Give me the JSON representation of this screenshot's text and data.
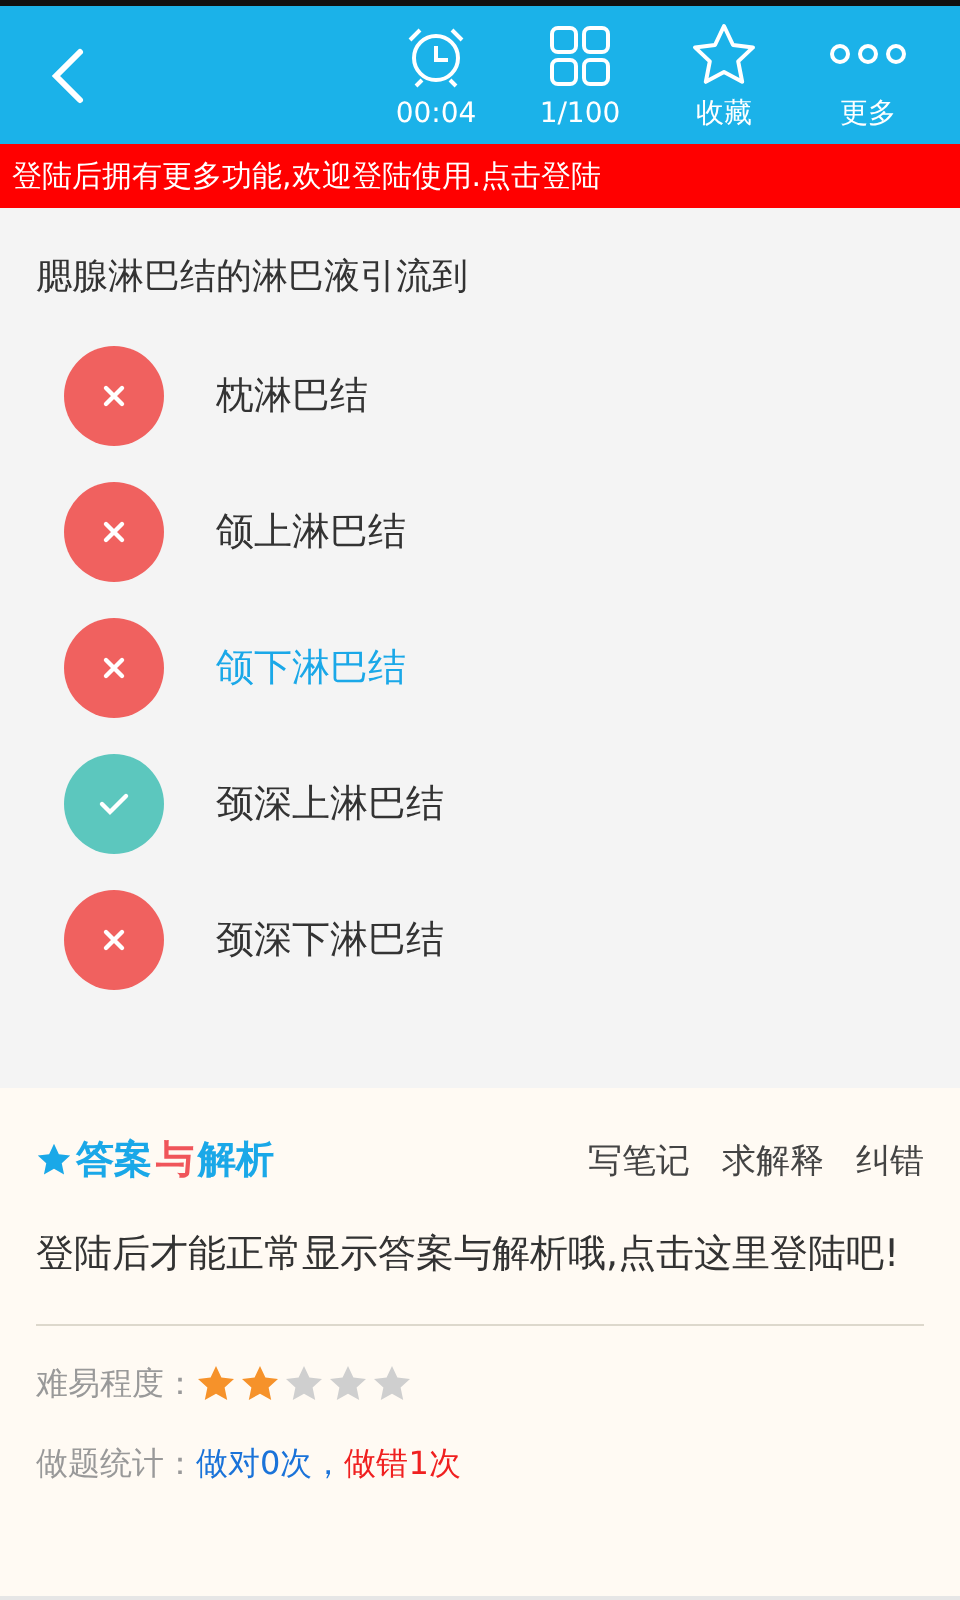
{
  "toolbar": {
    "items": [
      {
        "kind": "timer",
        "label": "00:04"
      },
      {
        "kind": "grid",
        "label": "1/100"
      },
      {
        "kind": "star",
        "label": "收藏"
      },
      {
        "kind": "more",
        "label": "更多"
      }
    ]
  },
  "banner": "登陆后拥有更多功能,欢迎登陆使用.点击登陆",
  "question": "腮腺淋巴结的淋巴液引流到",
  "options": [
    {
      "label": "枕淋巴结",
      "kind": "wrong",
      "selected": false
    },
    {
      "label": "颌上淋巴结",
      "kind": "wrong",
      "selected": false
    },
    {
      "label": "颌下淋巴结",
      "kind": "wrong",
      "selected": true
    },
    {
      "label": "颈深上淋巴结",
      "kind": "right",
      "selected": false
    },
    {
      "label": "颈深下淋巴结",
      "kind": "wrong",
      "selected": false
    }
  ],
  "answer_panel": {
    "logo": [
      {
        "text": "答案",
        "color": "#1aa8e8"
      },
      {
        "text": "与",
        "color": "#f0555a"
      },
      {
        "text": "解析",
        "color": "#1aa8e8"
      }
    ],
    "actions": [
      "写笔记",
      "求解释",
      "纠错"
    ],
    "message": "登陆后才能正常显示答案与解析哦,点击这里登陆吧!",
    "difficulty": {
      "label": "难易程度：",
      "stars": 2
    },
    "stats": {
      "label": "做题统计：",
      "correct": "做对0次",
      "separator": "，",
      "wrong": "做错1次"
    }
  }
}
